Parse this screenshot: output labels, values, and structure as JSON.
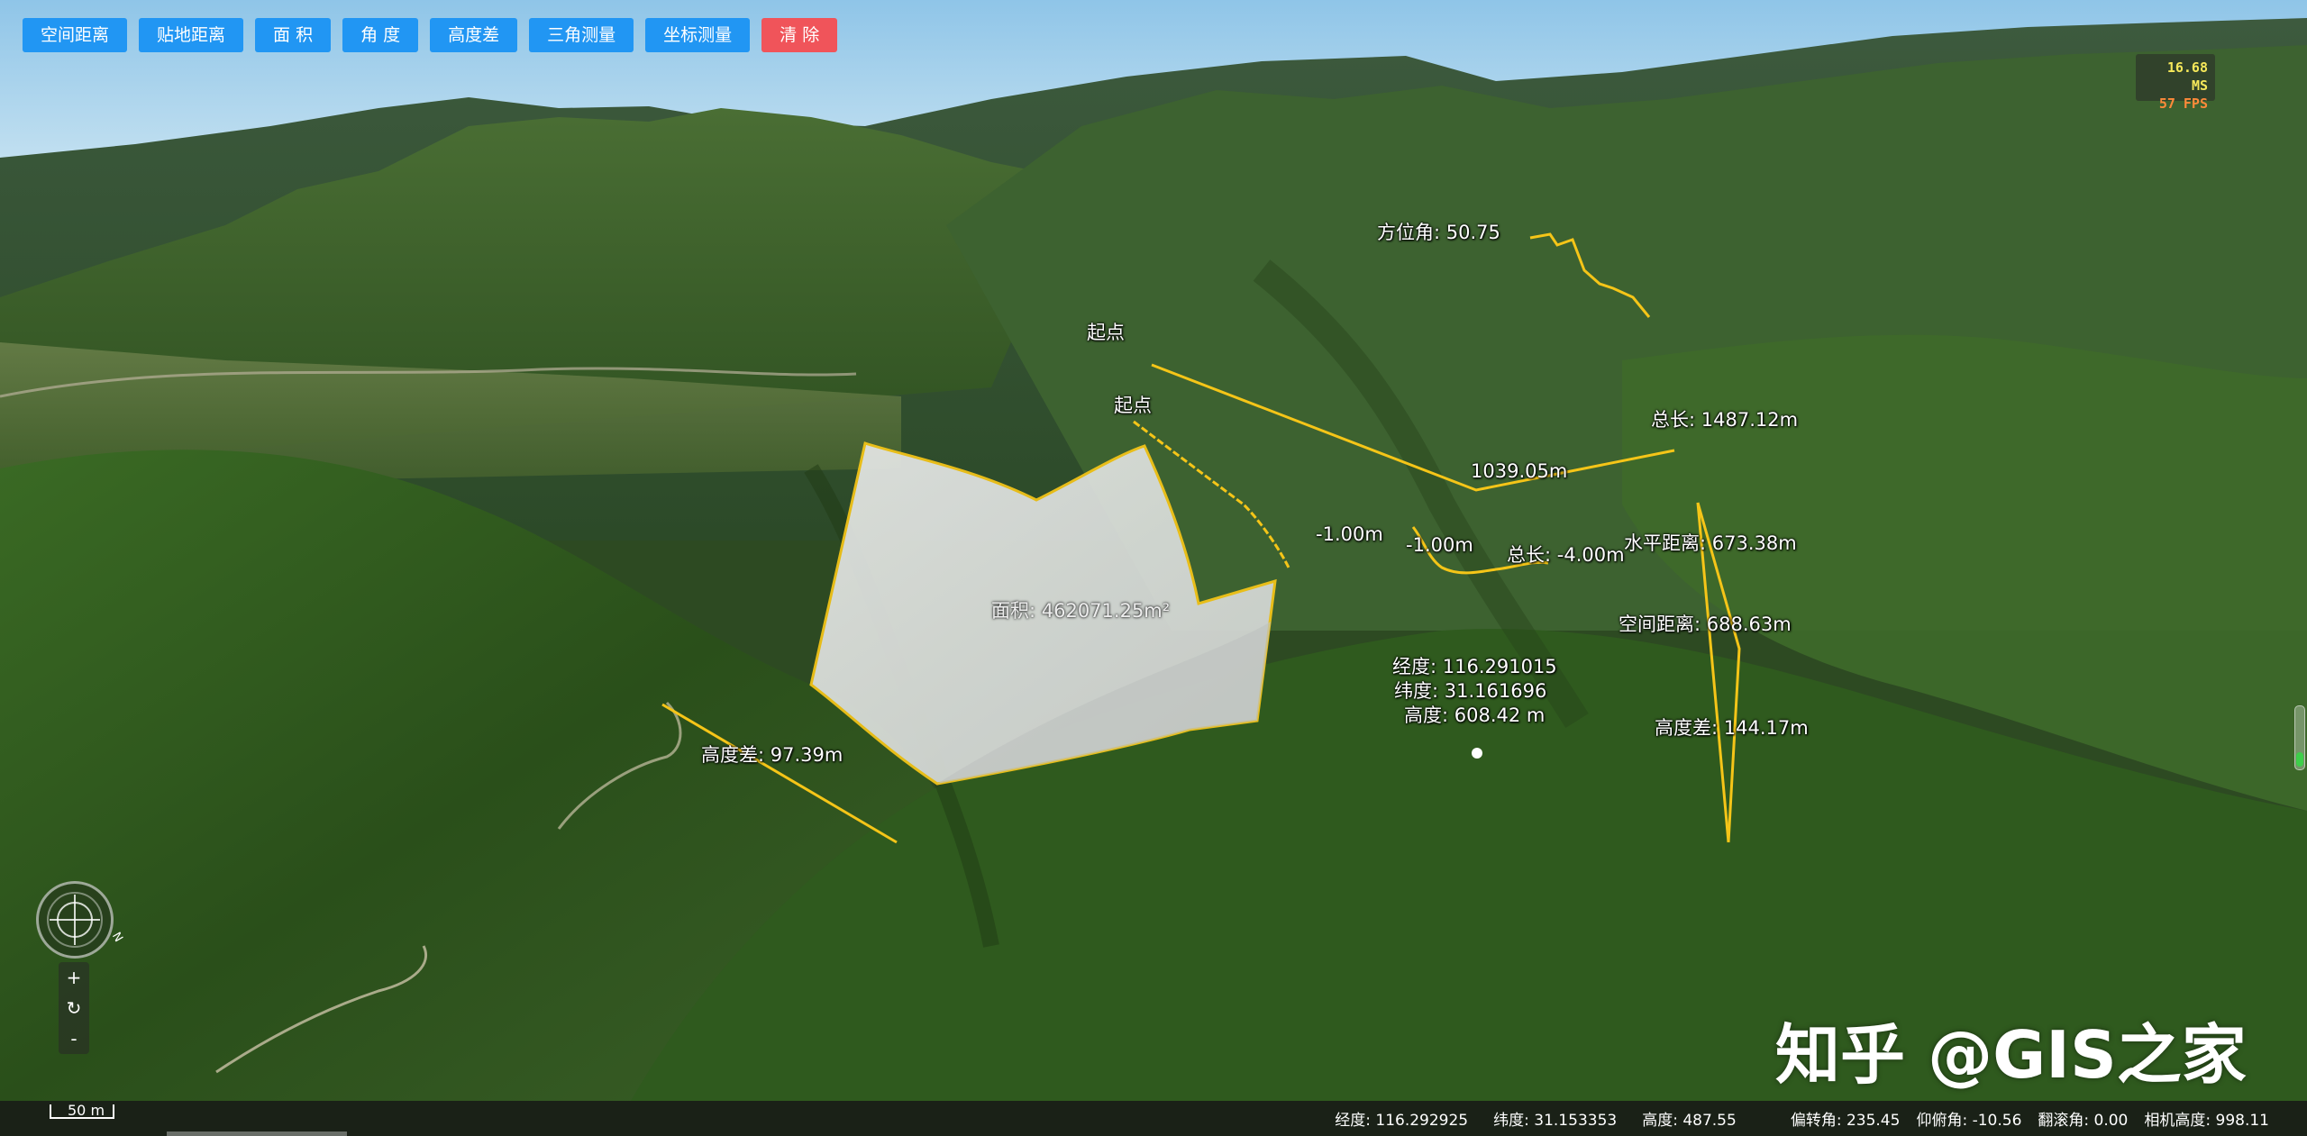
{
  "toolbar": {
    "buttons": [
      "空间距离",
      "贴地距离",
      "面 积",
      "角 度",
      "高度差",
      "三角测量",
      "坐标测量",
      "清 除"
    ]
  },
  "perf": {
    "ms": "16.68 MS",
    "fps": "57 FPS"
  },
  "labels": {
    "azimuth": "方位角: 50.75",
    "start1": "起点",
    "start2": "起点",
    "total_len": "总长: 1487.12m",
    "seg_len": "1039.05m",
    "neg1": "-1.00m",
    "neg2": "-1.00m",
    "total_neg": "总长: -4.00m",
    "horizontal": "水平距离: 673.38m",
    "space": "空间距离: 688.63m",
    "height_diff_right": "高度差: 144.17m",
    "area": "面积: 462071.25m²",
    "lon": "经度: 116.291015",
    "lat": "纬度: 31.161696",
    "alt": "高度: 608.42 m",
    "height_diff_left": "高度差: 97.39m"
  },
  "nav": {
    "north": "N",
    "zoom_in": "+",
    "reset": "↻",
    "zoom_out": "-"
  },
  "scale": "50 m",
  "status": {
    "lon": "经度: 116.292925",
    "lat": "纬度: 31.153353",
    "height": "高度: 487.55",
    "heading": "偏转角: 235.45",
    "pitch": "仰俯角: -10.56",
    "roll": "翻滚角: 0.00",
    "cam_height": "相机高度: 998.11"
  },
  "watermark": "知乎 @GIS之家",
  "colors": {
    "accent": "#2196f3",
    "danger": "#f0545a",
    "measure_line": "#f5c518"
  }
}
